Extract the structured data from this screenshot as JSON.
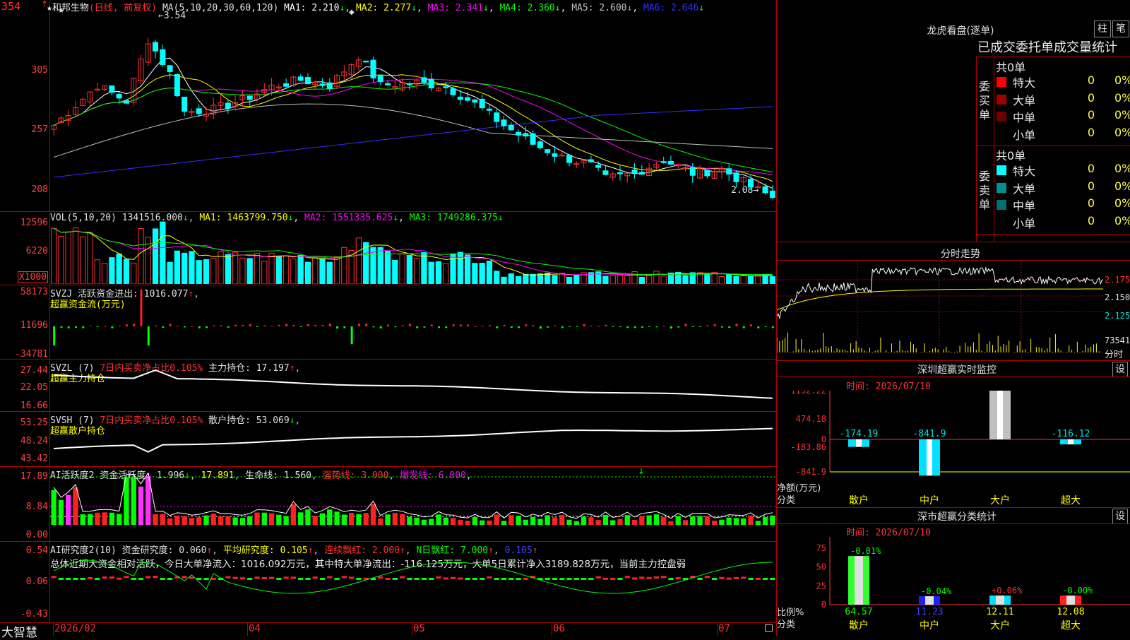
{
  "stock": {
    "name": "★和邦生物",
    "mode": "(日线, 前复权)",
    "ma_label": "MA(5,10,20,30,60,120)",
    "ma": [
      {
        "label": "MA1:",
        "value": "2.210",
        "arrow": "↓",
        "color": "#ffffff"
      },
      {
        "label": "MA2:",
        "value": "2.277",
        "arrow": "↓",
        "color": "#ffff00"
      },
      {
        "label": "MA3:",
        "value": "2.341",
        "arrow": "↓",
        "color": "#ff00ff"
      },
      {
        "label": "MA4:",
        "value": "2.360",
        "arrow": "↓",
        "color": "#00ff00"
      },
      {
        "label": "MA5:",
        "value": "2.600",
        "arrow": "↓",
        "color": "#c0c0c0"
      },
      {
        "label": "MA6:",
        "value": "2.646",
        "arrow": "↓",
        "color": "#3030ff"
      }
    ],
    "high_mark": "3.54",
    "low_mark": "2.08",
    "top_left_label": "354"
  },
  "price_axis": [
    "354",
    "305",
    "257",
    "208"
  ],
  "volume": {
    "header_label": "VOL(5,10,20)",
    "value": "1341516.000",
    "ma": [
      {
        "label": "MA1:",
        "value": "1463799.750",
        "arrow": "↓",
        "color": "#ffff00"
      },
      {
        "label": "MA2:",
        "value": "1551335.625",
        "arrow": "↓",
        "color": "#ff00ff"
      },
      {
        "label": "MA3:",
        "value": "1749286.375",
        "arrow": "↓",
        "color": "#00ff00"
      }
    ],
    "axis": [
      "12596",
      "6220"
    ],
    "unit": "X1000"
  },
  "svzj": {
    "line1_prefix": "SVZJ",
    "line1_label": "活跃资金进出:",
    "line1_value": "1016.077",
    "line1_arrow": "↑",
    "line2": "超赢资金流(万元)",
    "axis": [
      "58173",
      "11696",
      "-34781"
    ]
  },
  "svzl": {
    "prefix": "SVZL (7)",
    "red_text": "7日内买卖净占比0.105%",
    "label": "主力持仓:",
    "value": "17.197",
    "arrow": "↑",
    "line2": "超赢主力持仓",
    "axis": [
      "27.44",
      "22.05",
      "16.66"
    ]
  },
  "svsh": {
    "prefix": "SVSH (7)",
    "red_text": "7日内买卖净占比0.105%",
    "label": "散户持仓:",
    "value": "53.069",
    "arrow": "↓",
    "line2": "超赢散户持仓",
    "axis": [
      "53.25",
      "48.24",
      "43.42"
    ]
  },
  "ai_active": {
    "prefix": "AI活跃度2",
    "label1": "资金活跃度:",
    "value1": "1.996",
    "arrow1": "↓",
    "value2": "17.891",
    "label3": "生命线:",
    "value3": "1.560",
    "label4": "强势线:",
    "value4": "3.000",
    "label5": "爆发线:",
    "value5": "6.000",
    "axis": [
      "17.89",
      "8.84",
      "0.00"
    ]
  },
  "ai_research": {
    "prefix": "AI研究度2(10)",
    "label1": "资金研究度:",
    "value1": "0.060",
    "arrow1": "↑",
    "label2": "平均研究度:",
    "value2": "0.105",
    "arrow2": "↑",
    "label3": "连续飘红:",
    "value3": "2.000",
    "arrow3": "↑",
    "label4": "N日飘红:",
    "value4": "7.000",
    "arrow4": "↑",
    "value5": "0.105",
    "arrow5": "↑",
    "summary": "总体近期大资金相对活跃，今日大单净流入：1016.092万元，其中特大单净流出：-116.125万元，大单5日累计净入3189.828万元，当前主力控盘弱",
    "axis": [
      "0.54",
      "0.06",
      "-0.43"
    ]
  },
  "time_axis": {
    "brand": "大智慧",
    "labels": [
      "2026/02",
      "04",
      "05",
      "06",
      "07"
    ]
  },
  "right_panel": {
    "title": "龙虎看盘(逐单)",
    "btn1": "柱",
    "btn2": "笔",
    "stat_header": "已成交委托单成交量统计",
    "buy_group": {
      "vertical_label": "委买单",
      "total": "共0单",
      "rows": [
        {
          "name": "特大",
          "count": "0",
          "pct": "0%",
          "color": "#ff0000"
        },
        {
          "name": "大单",
          "count": "0",
          "pct": "0%",
          "color": "#a00000"
        },
        {
          "name": "中单",
          "count": "0",
          "pct": "0%",
          "color": "#700000"
        },
        {
          "name": "小单",
          "count": "0",
          "pct": "0%",
          "color": "#000000"
        }
      ]
    },
    "sell_group": {
      "vertical_label": "委卖单",
      "total": "共0单",
      "rows": [
        {
          "name": "特大",
          "count": "0",
          "pct": "0%",
          "color": "#00ffff"
        },
        {
          "name": "大单",
          "count": "0",
          "pct": "0%",
          "color": "#009090"
        },
        {
          "name": "中单",
          "count": "0",
          "pct": "0%",
          "color": "#007070"
        },
        {
          "name": "小单",
          "count": "0",
          "pct": "0%",
          "color": "#000000"
        }
      ]
    },
    "intraday": {
      "title": "分时走势",
      "axis": [
        "2.175",
        "2.150",
        "2.125"
      ],
      "vol_label": "73541",
      "unit_label": "分时"
    },
    "sz_monitor": {
      "title": "深圳超赢实时监控",
      "btn": "设",
      "time": "时间: 2026/07/10",
      "y_axis": [
        "1132.22",
        "474.18",
        "0",
        "-183.86",
        "-841.9"
      ],
      "y_title": "净额(万元)",
      "x_title": "分类",
      "categories": [
        "散户",
        "中户",
        "大户",
        "超大"
      ],
      "values": [
        -174.19,
        -841.9,
        1132.22,
        -116.12
      ],
      "value_labels": [
        "-174.19",
        "-841.9",
        "1132.22",
        "-116.12"
      ]
    },
    "sz_stats": {
      "title": "深市超赢分类统计",
      "btn": "设",
      "time": "时间: 2026/07/10",
      "y_axis": [
        "75",
        "50",
        "25",
        "0"
      ],
      "y_title": "比例%",
      "x_title": "分类",
      "categories": [
        "散户",
        "中户",
        "大户",
        "超大"
      ],
      "ratios": [
        64.57,
        11.23,
        12.11,
        12.08
      ],
      "changes": [
        "-0.01%",
        "-0.04%",
        "+0.06%",
        "-0.00%"
      ],
      "ratio_labels": [
        "64.57",
        "11.23",
        "12.11",
        "12.08"
      ]
    }
  }
}
